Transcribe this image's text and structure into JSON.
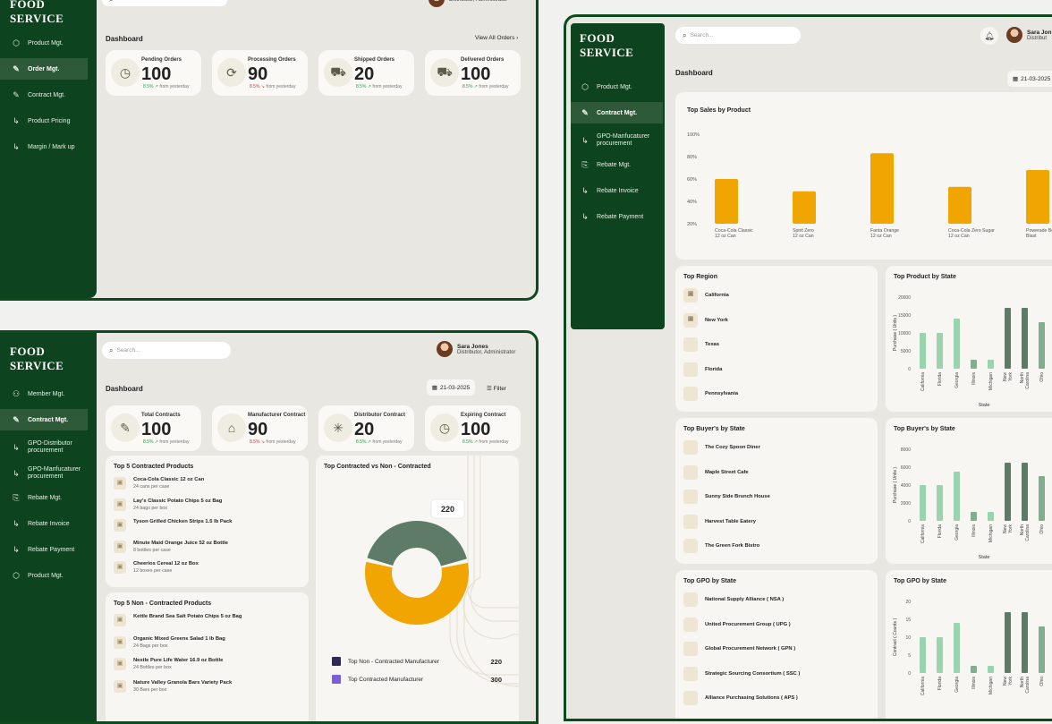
{
  "brand": "FOOD SERVICE",
  "search_placeholder": "Search...",
  "user": {
    "name": "Sara Jones",
    "role": "Distributor, Administrator",
    "role_short": "Distributor, Administrator"
  },
  "window1": {
    "nav": [
      {
        "label": "Product Mgt.",
        "icon": "box-icon"
      },
      {
        "label": "Order Mgt.",
        "icon": "edit-doc-icon",
        "active": true
      },
      {
        "label": "Contract Mgt.",
        "icon": "edit-doc-icon"
      },
      {
        "label": "Product Pricing",
        "icon": "sub-arrow-icon"
      },
      {
        "label": "Margin / Mark up",
        "icon": "sub-arrow-icon"
      }
    ],
    "title": "Dashboard",
    "view_all": "View All Orders",
    "stats": [
      {
        "label": "Pending Orders",
        "value": "100",
        "trend": "8.5%",
        "trend_dir": "up",
        "trend_suffix": "from yesterday",
        "icon": "clock-icon"
      },
      {
        "label": "Processing Orders",
        "value": "90",
        "trend": "8.5%",
        "trend_dir": "down",
        "trend_suffix": "from yesterday",
        "icon": "refresh-icon"
      },
      {
        "label": "Shipped Orders",
        "value": "20",
        "trend": "8.5%",
        "trend_dir": "up",
        "trend_suffix": "from yesterday",
        "icon": "truck-icon"
      },
      {
        "label": "Delivered Orders",
        "value": "100",
        "trend": "8.5%",
        "trend_dir": "up",
        "trend_suffix": "from yesterday",
        "icon": "delivered-truck-icon"
      }
    ]
  },
  "window2": {
    "nav": [
      {
        "label": "Member Mgt.",
        "icon": "members-icon"
      },
      {
        "label": "Contract Mgt.",
        "icon": "edit-doc-icon",
        "active": true
      },
      {
        "label": "GPO-Distributor procurement",
        "icon": "sub-arrow-icon"
      },
      {
        "label": "GPO-Manfucaturer procurement",
        "icon": "sub-arrow-icon"
      },
      {
        "label": "Rebate Mgt.",
        "icon": "rebate-icon"
      },
      {
        "label": "Rebate Invoice",
        "icon": "sub-arrow-icon"
      },
      {
        "label": "Rebate Payment",
        "icon": "sub-arrow-icon"
      },
      {
        "label": "Product Mgt.",
        "icon": "box-icon"
      }
    ],
    "title": "Dashboard",
    "date": "21-03-2025",
    "filter": "Filter",
    "stats": [
      {
        "label": "Total Contracts",
        "value": "100",
        "trend": "8.5%",
        "trend_dir": "up",
        "trend_suffix": "from yesterday",
        "icon": "contract-icon"
      },
      {
        "label": "Manufacturer Contract",
        "value": "90",
        "trend": "8.5%",
        "trend_dir": "down",
        "trend_suffix": "from yesterday",
        "icon": "factory-icon"
      },
      {
        "label": "Distributor Contract",
        "value": "20",
        "trend": "8.5%",
        "trend_dir": "up",
        "trend_suffix": "from yesterday",
        "icon": "network-icon"
      },
      {
        "label": "Expiring Contract",
        "value": "100",
        "trend": "8.5%",
        "trend_dir": "up",
        "trend_suffix": "from yesterday",
        "icon": "clock-icon"
      }
    ],
    "top5_contracted": {
      "title": "Top 5 Contracted Products",
      "items": [
        {
          "name": "Coca-Cola Classic 12 oz Can",
          "sub": "24 cans per case"
        },
        {
          "name": "Lay's Classic Potato Chips 5 oz Bag",
          "sub": "24 bags per box"
        },
        {
          "name": "Tyson Grilled Chicken Strips 1.5 lb Pack",
          "sub": ""
        },
        {
          "name": "Minute Maid Orange Juice 52 oz Bottle",
          "sub": "8 bottles per case"
        },
        {
          "name": "Cheerios Cereal 12 oz Box",
          "sub": "12 boxes per case"
        }
      ]
    },
    "top5_non": {
      "title": "Top 5 Non - Contracted Products",
      "items": [
        {
          "name": "Kettle Brand Sea Salt Potato Chips 5 oz Bag",
          "sub": ""
        },
        {
          "name": "Organic Mixed Greens Salad 1 lb Bag",
          "sub": "24 Bags per box"
        },
        {
          "name": "Nestle Pure Life Water 16.9 oz Bottle",
          "sub": "24 Bottles per box"
        },
        {
          "name": "Nature Valley Granola Bars Variety Pack",
          "sub": "30 Bars per box"
        }
      ]
    },
    "donut": {
      "title": "Top Contracted vs Non - Contracted",
      "tooltip": "220",
      "legend": [
        {
          "label": "Top Non - Contracted Manufacturer",
          "value": "220",
          "color": "#2e2a55"
        },
        {
          "label": "Top Contracted Manufacturer",
          "value": "300",
          "color": "#7a5fd6"
        }
      ]
    }
  },
  "window3": {
    "nav": [
      {
        "label": "Product Mgt.",
        "icon": "box-icon"
      },
      {
        "label": "Contract Mgt.",
        "icon": "edit-doc-icon",
        "active": true
      },
      {
        "label": "GPO-Manfucaturer procurement",
        "icon": "sub-arrow-icon"
      },
      {
        "label": "Rebate Mgt.",
        "icon": "rebate-icon"
      },
      {
        "label": "Rebate Invoice",
        "icon": "sub-arrow-icon"
      },
      {
        "label": "Rebate Payment",
        "icon": "sub-arrow-icon"
      }
    ],
    "title": "Dashboard",
    "date": "21-03-2025",
    "user_name": "Sara Jon",
    "user_role": "Distribut",
    "top_region": {
      "title": "Top  Region",
      "items": [
        "California",
        "New York",
        "Texas",
        "Florida",
        "Pennsylvania"
      ]
    },
    "top_buyers": {
      "title": "Top Buyer's by State",
      "items": [
        "The Cozy Spoon Diner",
        "Maple Street Cafe",
        "Sunny Side Brunch House",
        "Harvest Table Eatery",
        "The Green Fork Bistro"
      ]
    },
    "top_gpo": {
      "title": "Top GPO by State",
      "items": [
        "National Supply Alliance ( NSA )",
        "United Procurement Group ( UPG )",
        "Global Procurement Network ( GPN )",
        "Strategic Sourcing Consortium ( SSC )",
        "Alliance Purchasing Solutions ( APS )"
      ]
    }
  },
  "chart_data": [
    {
      "type": "bar",
      "title": "Top Sales by Product",
      "categories": [
        "Coca-Cola Classic 12 oz Can",
        "Spirit Zero 12 oz Can",
        "Fanta Orange 12 oz Can",
        "Coca-Cola Zero Sugar 12 oz Can",
        "Powerade Berry Blast"
      ],
      "values": [
        60,
        49,
        83,
        53,
        68
      ],
      "yticks": [
        "100%",
        "80%",
        "60%",
        "40%",
        "20%"
      ],
      "ylim": [
        20,
        100
      ],
      "color": "#f0a500"
    },
    {
      "type": "pie",
      "title": "Top Contracted vs Non - Contracted",
      "series": [
        {
          "name": "Top Non - Contracted Manufacturer",
          "value": 220
        },
        {
          "name": "Top Contracted Manufacturer",
          "value": 300
        }
      ]
    },
    {
      "type": "bar",
      "title": "Top Product by State",
      "ylabel": "Purchase ( Units )",
      "xlabel": "State",
      "categories": [
        "California",
        "Florida",
        "Georgia",
        "Illinois",
        "Michigan",
        "New York",
        "North Carolina",
        "Ohio"
      ],
      "values": [
        10000,
        10000,
        14000,
        2500,
        2500,
        17000,
        17000,
        13000
      ],
      "yticks": [
        "20000",
        "15000",
        "10000",
        "5000",
        "0"
      ],
      "ylim": [
        0,
        20000
      ]
    },
    {
      "type": "bar",
      "title": "Top Buyer's by State",
      "ylabel": "Purchase ( Units )",
      "xlabel": "State",
      "categories": [
        "California",
        "Florida",
        "Georgia",
        "Illinois",
        "Michigan",
        "New York",
        "North Carolina",
        "Ohio"
      ],
      "values": [
        4000,
        4000,
        5500,
        1000,
        1000,
        6500,
        6500,
        5000
      ],
      "yticks": [
        "8000",
        "6000",
        "4000",
        "2000",
        "0"
      ],
      "ylim": [
        0,
        8000
      ]
    },
    {
      "type": "bar",
      "title": "Top GPO by State",
      "ylabel": "Contract ( Counts )",
      "xlabel": "",
      "categories": [
        "California",
        "Florida",
        "Georgia",
        "Illinois",
        "Michigan",
        "New York",
        "North Carolina",
        "Ohio"
      ],
      "values": [
        10,
        10,
        14,
        2,
        2,
        17,
        17,
        13
      ],
      "yticks": [
        "20",
        "15",
        "10",
        "5",
        "0"
      ],
      "ylim": [
        0,
        20
      ]
    }
  ]
}
